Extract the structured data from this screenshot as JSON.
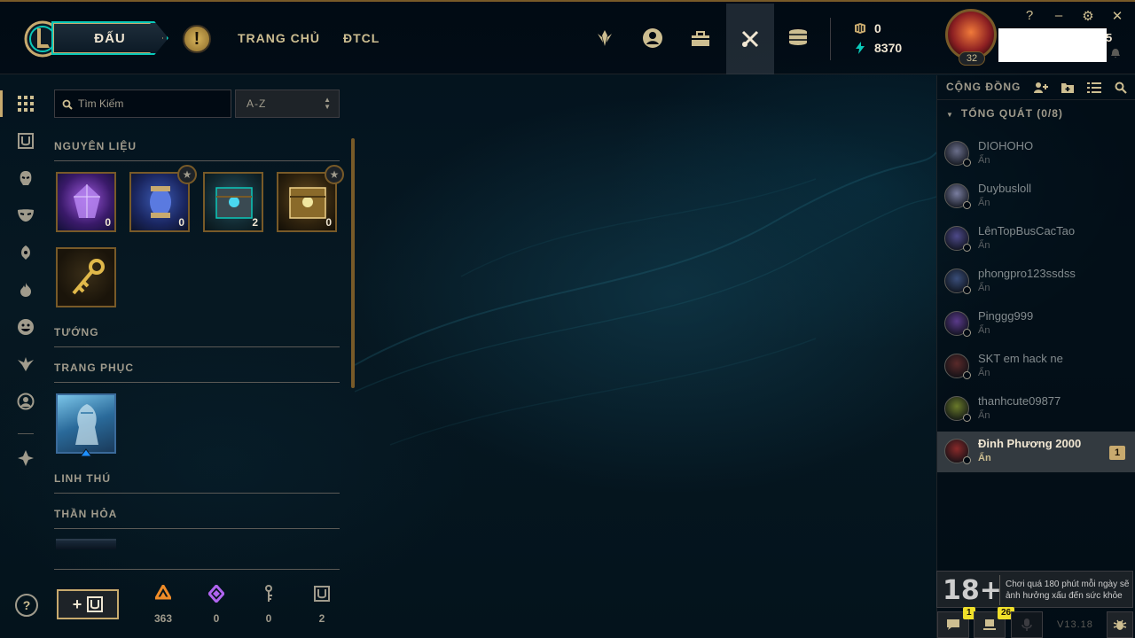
{
  "topbar": {
    "play_label": "ĐẤU",
    "nav": [
      {
        "label": "TRANG CHỦ"
      },
      {
        "label": "ĐTCL"
      }
    ],
    "icons": [
      "ranked-icon",
      "profile-icon",
      "collection-icon",
      "loot-icon",
      "store-icon"
    ],
    "currency": {
      "rp": "0",
      "be": "8370"
    },
    "profile_level": "32",
    "name_fragment": "5",
    "window": {
      "help": "?",
      "minimize": "–",
      "settings": "⚙",
      "close": "✕"
    }
  },
  "loot": {
    "search_placeholder": "Tìm Kiếm",
    "sort_value": "A-Z",
    "sections": {
      "materials": "NGUYÊN LIỆU",
      "champions": "TƯỚNG",
      "skins": "TRANG PHỤC",
      "companions": "LINH THÚ",
      "emotes": "THẦN HỎA"
    },
    "materials": [
      {
        "name": "essence",
        "count": "0",
        "starred": false
      },
      {
        "name": "orb",
        "count": "0",
        "starred": true
      },
      {
        "name": "hextech-chest",
        "count": "2",
        "starred": false
      },
      {
        "name": "masterwork-chest",
        "count": "0",
        "starred": true
      },
      {
        "name": "key",
        "count": "",
        "starred": false
      }
    ],
    "craft_label": "+",
    "resources": [
      {
        "name": "orange-essence",
        "value": "363"
      },
      {
        "name": "mythic-essence",
        "value": "0"
      },
      {
        "name": "key-fragment",
        "value": "0"
      },
      {
        "name": "chest",
        "value": "2"
      }
    ]
  },
  "social": {
    "title": "CỘNG ĐỒNG",
    "group": "TỔNG QUÁT (0/8)",
    "friends": [
      {
        "name": "DIOHOHO",
        "status": "Ẩn",
        "color": "#6a6e8a"
      },
      {
        "name": "Duybusloll",
        "status": "Ẩn",
        "color": "#7a7ea0"
      },
      {
        "name": "LênTopBusCacTao",
        "status": "Ẩn",
        "color": "#4e4a8a"
      },
      {
        "name": "phongpro123ssdss",
        "status": "Ẩn",
        "color": "#3a4e7a"
      },
      {
        "name": "Pinggg999",
        "status": "Ẩn",
        "color": "#5a3a8a"
      },
      {
        "name": "SKT em hack ne",
        "status": "Ẩn",
        "color": "#5a2a2a"
      },
      {
        "name": "thanhcute09877",
        "status": "Ẩn",
        "color": "#6a7a2a"
      },
      {
        "name": "Đinh Phương 2000",
        "status": "Ẩn",
        "color": "#8a2a2a",
        "unread": "1",
        "active": true
      }
    ],
    "warning_age": "18+",
    "warning_text": "Chơi quá 180 phút mỗi ngày sẽ ảnh hưởng xấu đến sức khỏe",
    "chat_badge": "1",
    "notes_badge": "26",
    "version": "V13.18"
  }
}
